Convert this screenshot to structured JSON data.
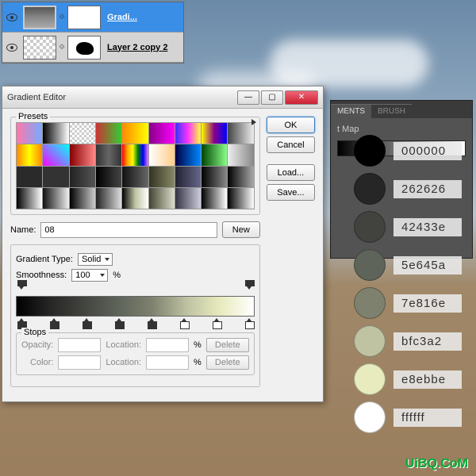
{
  "layers": {
    "row1": {
      "label": "Gradi..."
    },
    "row2": {
      "label": "Layer 2 copy 2"
    }
  },
  "gradient_editor": {
    "title": "Gradient Editor",
    "presets_label": "Presets",
    "buttons": {
      "ok": "OK",
      "cancel": "Cancel",
      "load": "Load...",
      "save": "Save...",
      "new": "New"
    },
    "name_label": "Name:",
    "name_value": "08",
    "type_label": "Gradient Type:",
    "type_value": "Solid",
    "smooth_label": "Smoothness:",
    "smooth_value": "100",
    "percent": "%",
    "stops_label": "Stops",
    "opacity_label": "Opacity:",
    "location_label": "Location:",
    "color_label": "Color:",
    "delete_label": "Delete",
    "preset_colors": [
      "linear-gradient(90deg,#f7a,#7af)",
      "linear-gradient(90deg,#000,#fff)",
      "repeating-conic-gradient(#ccc 0 25%,#fff 0 50%) 0 0/6px 6px",
      "linear-gradient(90deg,#c33,#3c3)",
      "linear-gradient(90deg,#f80,#ff0)",
      "linear-gradient(90deg,#808,#f0f)",
      "linear-gradient(90deg,#33f,#f3f,#ff3)",
      "linear-gradient(90deg,#ff0,#808,#00f)",
      "linear-gradient(90deg,#444,#eee)",
      "linear-gradient(90deg,#f80,#ff0,#f80)",
      "linear-gradient(45deg,#f0f,#0ff)",
      "linear-gradient(90deg,#800,#f88)",
      "linear-gradient(90deg,#333,#666,#333)",
      "linear-gradient(90deg,red,orange,yellow,green,blue,violet)",
      "linear-gradient(90deg,#fff,#fc8)",
      "linear-gradient(90deg,#004,#08f)",
      "linear-gradient(90deg,#040,#8f8)",
      "linear-gradient(90deg,#eee,#888)",
      "#2a2a2a",
      "#333",
      "linear-gradient(90deg,#222,#555)",
      "linear-gradient(90deg,#000,#444)",
      "linear-gradient(90deg,#111,#666)",
      "linear-gradient(90deg,#332,#886)",
      "linear-gradient(90deg,#223,#668)",
      "linear-gradient(90deg,#000,#888)",
      "linear-gradient(90deg,#000,#aaa)",
      "linear-gradient(90deg,#000,#fff)",
      "linear-gradient(90deg,#111,#eee)",
      "linear-gradient(90deg,#000,#ccc)",
      "linear-gradient(90deg,#222,#ddd)",
      "linear-gradient(90deg,#000,#bfc3a2,#fff)",
      "linear-gradient(90deg,#443,#ddc)",
      "linear-gradient(90deg,#334,#ccd)",
      "linear-gradient(90deg,#000,#fff)",
      "linear-gradient(90deg,#000,#fff)"
    ]
  },
  "adjustments": {
    "tab1": "MENTS",
    "tab2": "BRUSH",
    "heading": "t Map"
  },
  "colors": [
    {
      "hex": "000000",
      "c": "#000000"
    },
    {
      "hex": "262626",
      "c": "#262626"
    },
    {
      "hex": "42433e",
      "c": "#42433e"
    },
    {
      "hex": "5e645a",
      "c": "#5e645a"
    },
    {
      "hex": "7e816e",
      "c": "#7e816e"
    },
    {
      "hex": "bfc3a2",
      "c": "#bfc3a2"
    },
    {
      "hex": "e8ebbe",
      "c": "#e8ebbe"
    },
    {
      "hex": "ffffff",
      "c": "#ffffff"
    }
  ],
  "watermark": "UiBQ.CoM"
}
